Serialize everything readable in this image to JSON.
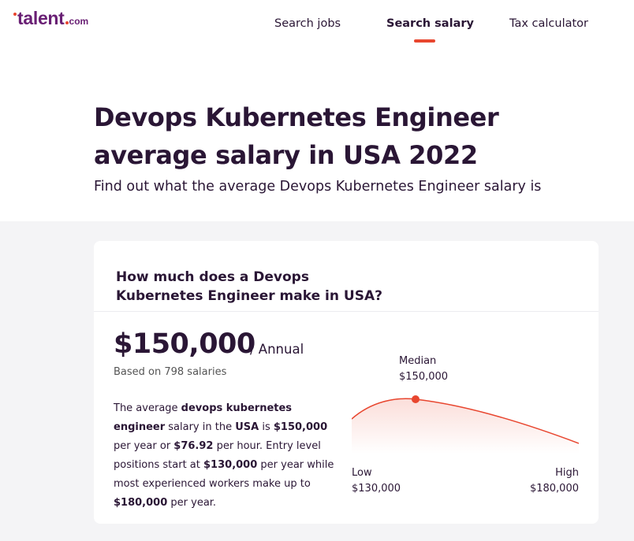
{
  "brand": {
    "name": "talent",
    "tld": "com"
  },
  "nav": {
    "items": [
      "Search jobs",
      "Search salary",
      "Tax calculator"
    ],
    "active_index": 1
  },
  "hero": {
    "title": "Devops Kubernetes Engineer average salary in USA 2022",
    "subtitle": "Find out what the average Devops Kubernetes Engineer salary is"
  },
  "card": {
    "question": "How much does a Devops Kubernetes Engineer make in USA?",
    "amount": "$150,000",
    "period": "/ Annual",
    "based_on": "Based on 798 salaries",
    "description": {
      "t1": "The average ",
      "job": "devops kubernetes engineer",
      "t2": " salary in the ",
      "country": "USA",
      "t3": " is ",
      "year": "$150,000",
      "t4": " per year or ",
      "hour": "$76.92",
      "t5": " per hour. Entry level positions start at ",
      "entry": "$130,000",
      "t6": " per year while most experienced workers make up to ",
      "top": "$180,000",
      "t7": " per year."
    }
  },
  "chart_data": {
    "type": "area",
    "median_label": "Median",
    "median_value": "$150,000",
    "low_label": "Low",
    "low_value": "$130,000",
    "high_label": "High",
    "high_value": "$180,000",
    "x": [
      130000,
      150000,
      180000
    ],
    "accent_color": "#e8462f"
  }
}
